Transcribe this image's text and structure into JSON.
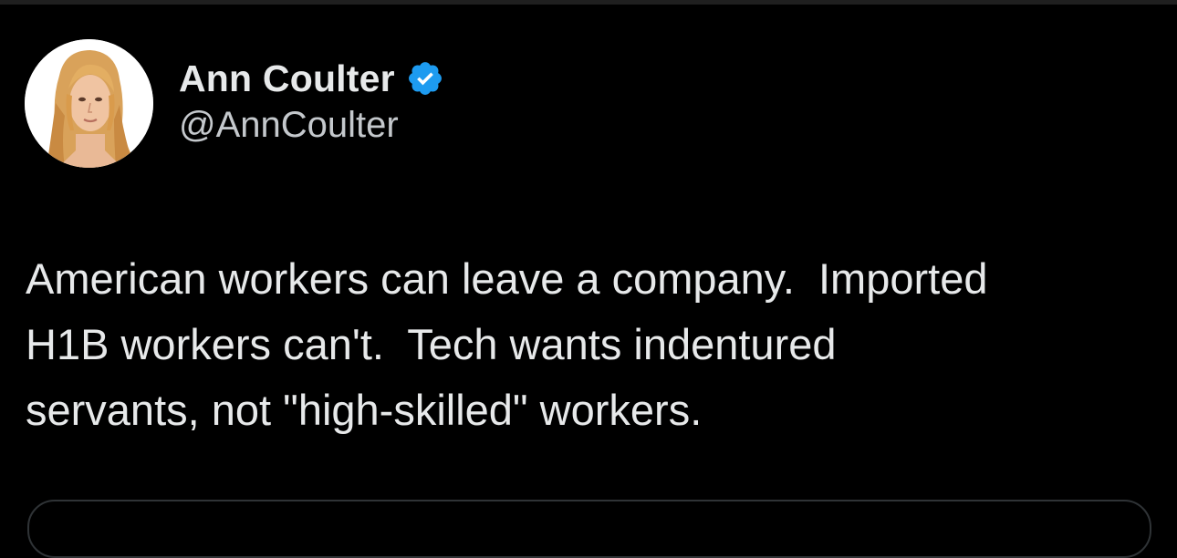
{
  "tweet": {
    "author": {
      "display_name": "Ann Coulter",
      "handle": "@AnnCoulter",
      "verified": true,
      "avatar_icon": "profile-photo",
      "badge_icon": "verified-badge-icon"
    },
    "text": "American workers can leave a company.  Imported\nH1B workers can't.  Tech wants indentured\nservants, not \"high-skilled\" workers."
  },
  "colors": {
    "background": "#000000",
    "text_primary": "#e7e9ea",
    "text_secondary": "#c4c8cc",
    "verified_blue": "#1d9bf0",
    "border": "#2f3336"
  }
}
